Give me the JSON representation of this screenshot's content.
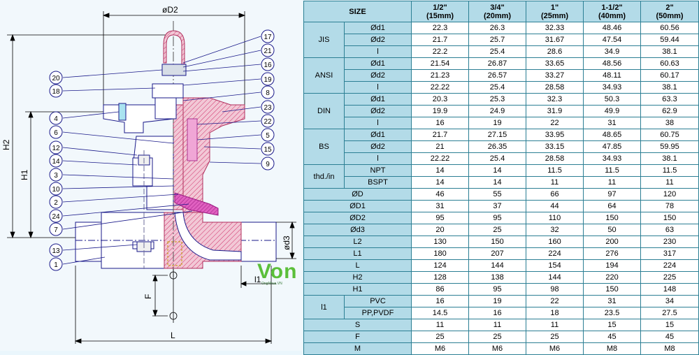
{
  "drawing": {
    "dim_labels": {
      "D2": "øD2",
      "H2": "H2",
      "H1": "H1",
      "d3": "ød3",
      "l1": "l1",
      "F": "F",
      "L": "L"
    },
    "callouts_left": [
      "20",
      "18",
      "4",
      "6",
      "12",
      "14",
      "3",
      "10",
      "2",
      "24",
      "7",
      "13",
      "1"
    ],
    "callouts_right": [
      "17",
      "21",
      "16",
      "19",
      "8",
      "23",
      "22",
      "5",
      "15",
      "9"
    ],
    "watermark": {
      "brand": "Von",
      "sub": "OngNhua.VN"
    }
  },
  "table": {
    "header": {
      "size": "SIZE",
      "cols": [
        [
          "1/2\"",
          "(15mm)"
        ],
        [
          "3/4\"",
          "(20mm)"
        ],
        [
          "1\"",
          "(25mm)"
        ],
        [
          "1-1/2\"",
          "(40mm)"
        ],
        [
          "2\"",
          "(50mm)"
        ]
      ]
    },
    "groups": [
      {
        "name": "JIS",
        "rows": [
          {
            "label": "Ød1",
            "values": [
              "22.3",
              "26.3",
              "32.33",
              "48.46",
              "60.56"
            ]
          },
          {
            "label": "Ød2",
            "values": [
              "21.7",
              "25.7",
              "31.67",
              "47.54",
              "59.44"
            ]
          },
          {
            "label": "l",
            "values": [
              "22.2",
              "25.4",
              "28.6",
              "34.9",
              "38.1"
            ]
          }
        ]
      },
      {
        "name": "ANSI",
        "rows": [
          {
            "label": "Ød1",
            "values": [
              "21.54",
              "26.87",
              "33.65",
              "48.56",
              "60.63"
            ]
          },
          {
            "label": "Ød2",
            "values": [
              "21.23",
              "26.57",
              "33.27",
              "48.11",
              "60.17"
            ]
          },
          {
            "label": "l",
            "values": [
              "22.22",
              "25.4",
              "28.58",
              "34.93",
              "38.1"
            ]
          }
        ]
      },
      {
        "name": "DIN",
        "rows": [
          {
            "label": "Ød1",
            "values": [
              "20.3",
              "25.3",
              "32.3",
              "50.3",
              "63.3"
            ]
          },
          {
            "label": "Ød2",
            "values": [
              "19.9",
              "24.9",
              "31.9",
              "49.9",
              "62.9"
            ]
          },
          {
            "label": "l",
            "values": [
              "16",
              "19",
              "22",
              "31",
              "38"
            ]
          }
        ]
      },
      {
        "name": "BS",
        "rows": [
          {
            "label": "Ød1",
            "values": [
              "21.7",
              "27.15",
              "33.95",
              "48.65",
              "60.75"
            ]
          },
          {
            "label": "Ød2",
            "values": [
              "21",
              "26.35",
              "33.15",
              "47.85",
              "59.95"
            ]
          },
          {
            "label": "l",
            "values": [
              "22.22",
              "25.4",
              "28.58",
              "34.93",
              "38.1"
            ]
          }
        ]
      },
      {
        "name": "thd./in",
        "rows": [
          {
            "label": "NPT",
            "values": [
              "14",
              "14",
              "11.5",
              "11.5",
              "11.5"
            ]
          },
          {
            "label": "BSPT",
            "values": [
              "14",
              "14",
              "11",
              "11",
              "11"
            ]
          }
        ]
      }
    ],
    "singles": [
      {
        "label": "ØD",
        "values": [
          "46",
          "55",
          "66",
          "97",
          "120"
        ]
      },
      {
        "label": "ØD1",
        "values": [
          "31",
          "37",
          "44",
          "64",
          "78"
        ]
      },
      {
        "label": "ØD2",
        "values": [
          "95",
          "95",
          "110",
          "150",
          "150"
        ]
      },
      {
        "label": "Ød3",
        "values": [
          "20",
          "25",
          "32",
          "50",
          "63"
        ]
      },
      {
        "label": "L2",
        "values": [
          "130",
          "150",
          "160",
          "200",
          "230"
        ]
      },
      {
        "label": "L1",
        "values": [
          "180",
          "207",
          "224",
          "276",
          "317"
        ]
      },
      {
        "label": "L",
        "values": [
          "124",
          "144",
          "154",
          "194",
          "224"
        ]
      },
      {
        "label": "H2",
        "values": [
          "128",
          "138",
          "144",
          "220",
          "225"
        ]
      },
      {
        "label": "H1",
        "values": [
          "86",
          "95",
          "98",
          "150",
          "148"
        ]
      }
    ],
    "l1_group": {
      "name": "l1",
      "rows": [
        {
          "label": "PVC",
          "values": [
            "16",
            "19",
            "22",
            "31",
            "34"
          ]
        },
        {
          "label": "PP,PVDF",
          "values": [
            "14.5",
            "16",
            "18",
            "23.5",
            "27.5"
          ]
        }
      ]
    },
    "tail": [
      {
        "label": "S",
        "values": [
          "11",
          "11",
          "11",
          "15",
          "15"
        ]
      },
      {
        "label": "F",
        "values": [
          "25",
          "25",
          "25",
          "45",
          "45"
        ]
      },
      {
        "label": "M",
        "values": [
          "M6",
          "M6",
          "M6",
          "M8",
          "M8"
        ]
      }
    ]
  }
}
